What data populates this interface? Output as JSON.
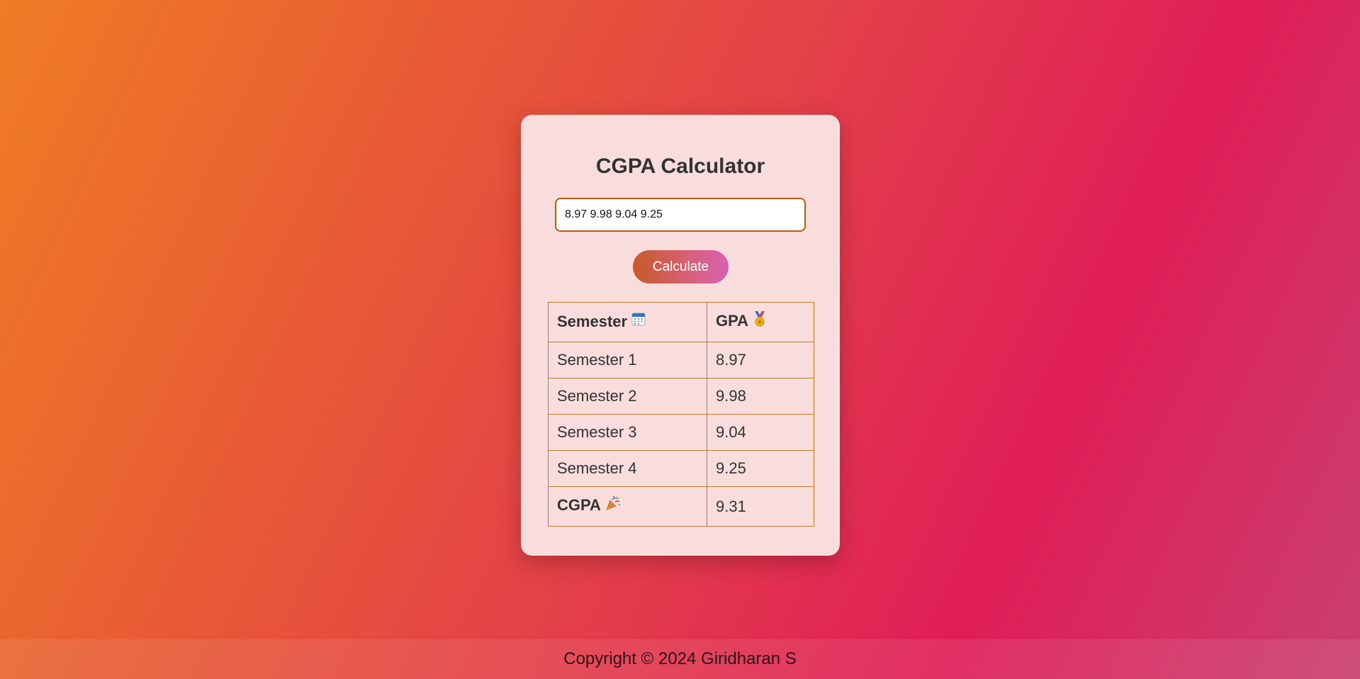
{
  "app": {
    "title": "CGPA Calculator"
  },
  "form": {
    "input_value": "8.97 9.98 9.04 9.25",
    "calculate_label": "Calculate"
  },
  "table": {
    "headers": {
      "semester": "Semester",
      "semester_icon": "calendar-icon",
      "gpa": "GPA",
      "gpa_icon": "medal-icon"
    },
    "rows": [
      {
        "semester": "Semester 1",
        "gpa": "8.97"
      },
      {
        "semester": "Semester 2",
        "gpa": "9.98"
      },
      {
        "semester": "Semester 3",
        "gpa": "9.04"
      },
      {
        "semester": "Semester 4",
        "gpa": "9.25"
      }
    ],
    "total": {
      "label": "CGPA",
      "icon": "party-popper-icon",
      "value": "9.31"
    }
  },
  "footer": {
    "text": "Copyright © 2024 Giridharan S"
  },
  "colors": {
    "card_background": "#f9dcdc",
    "border_accent": "#c2570f",
    "background_start": "#f07c24",
    "background_end": "#e01e58"
  }
}
